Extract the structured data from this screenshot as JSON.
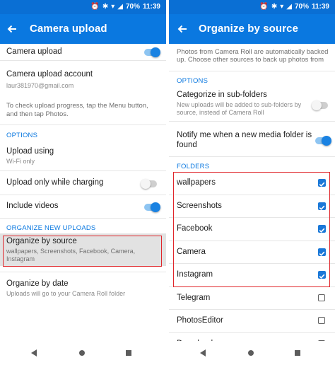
{
  "status_bar": {
    "time": "11:39",
    "battery": "70%"
  },
  "left_screen": {
    "title": "Camera upload",
    "camera_upload_label": "Camera upload",
    "camera_upload_on": true,
    "account": {
      "label": "Camera upload account",
      "email": "laur381970@gmail.com"
    },
    "help_text": "To check upload progress, tap the Menu button, and then tap Photos.",
    "options_header": "OPTIONS",
    "upload_using": {
      "label": "Upload using",
      "value": "Wi-Fi only"
    },
    "upload_charging": {
      "label": "Upload only while charging",
      "on": false
    },
    "include_videos": {
      "label": "Include videos",
      "on": true
    },
    "organize_header": "ORGANIZE NEW UPLOADS",
    "organize_source": {
      "label": "Organize by source",
      "sub_line1": "wallpapers, Screenshots, Facebook, Camera,",
      "sub_line2": "Instagram"
    },
    "organize_date": {
      "label": "Organize by date",
      "sub": "Uploads will go to your Camera Roll folder"
    }
  },
  "right_screen": {
    "title": "Organize by source",
    "intro_line1": "Photos from Camera Roll are automatically backed",
    "intro_line2": "up. Choose other sources to back up photos from",
    "options_header": "OPTIONS",
    "categorize": {
      "label": "Categorize in sub-folders",
      "sub_line1": "New uploads will be added to sub-folders by",
      "sub_line2": "source, instead of Camera Roll",
      "on": false
    },
    "notify": {
      "label_line1": "Notify me when a new media folder is",
      "label_line2": "found",
      "on": true
    },
    "folders_header": "FOLDERS",
    "folders": [
      {
        "name": "wallpapers",
        "checked": true
      },
      {
        "name": "Screenshots",
        "checked": true
      },
      {
        "name": "Facebook",
        "checked": true
      },
      {
        "name": "Camera",
        "checked": true
      },
      {
        "name": "Instagram",
        "checked": true
      },
      {
        "name": "Telegram",
        "checked": false
      },
      {
        "name": "PhotosEditor",
        "checked": false
      },
      {
        "name": "Download",
        "checked": false
      }
    ]
  },
  "colors": {
    "accent": "#0a78e0",
    "highlight": "#e0262b"
  }
}
